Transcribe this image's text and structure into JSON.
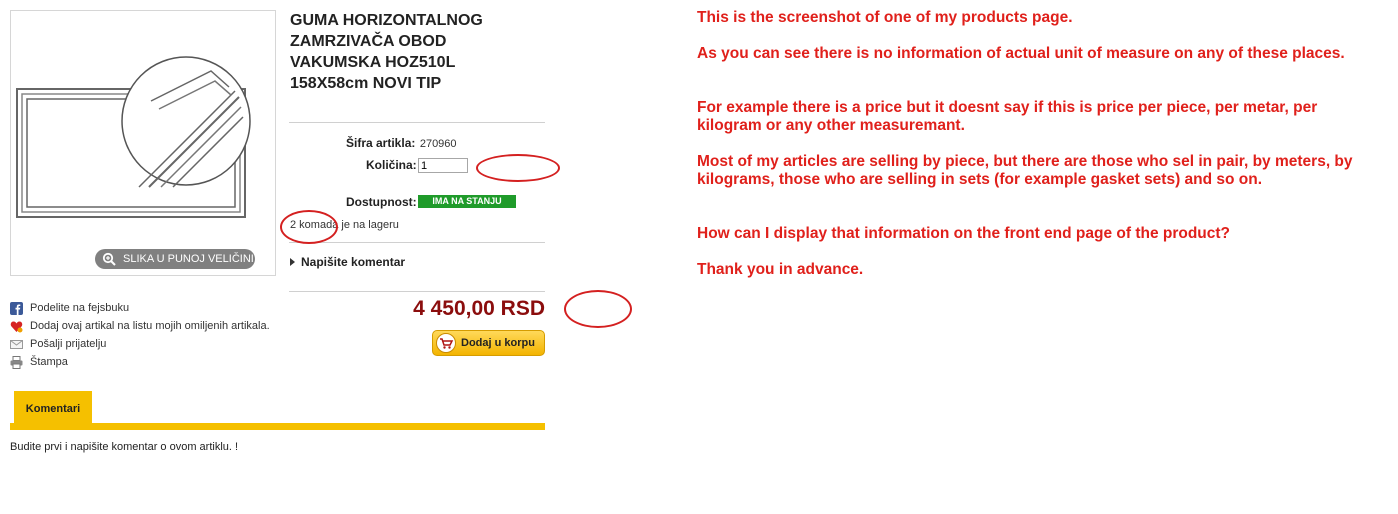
{
  "product": {
    "title": "GUMA HORIZONTALNOG ZAMRZIVAČA OBOD VAKUMSKA HOZ510L 158X58cm NOVI TIP",
    "zoom_label": "SLIKA U PUNOJ VELIČINI",
    "sku_label": "Šifra artikla:",
    "sku_value": "270960",
    "qty_label": "Količina:",
    "qty_value": "1",
    "availability_label": "Dostupnost:",
    "availability_badge": "IMA NA STANJU",
    "stock_count": "2 komada",
    "stock_suffix": "je na lageru",
    "comment_link": "Napišite komentar",
    "price": "4 450,00 RSD",
    "add_to_cart": "Dodaj u korpu"
  },
  "share": {
    "facebook": "Podelite na fejsbuku",
    "favorites": "Dodaj ovaj artikal na listu mojih omiljenih artikala.",
    "send_friend": "Pošalji prijatelju",
    "print": "Štampa"
  },
  "tabs": {
    "comments_label": "Komentari",
    "comments_text": "Budite prvi i napišite komentar o ovom artiklu. !"
  },
  "annotation": {
    "line1": "This is the screenshot of one of my products page.",
    "line2": "As you can see there is no information of actual unit of measure on any of these places.",
    "line3": "For example there is a price but it doesnt say if this is price per piece, per metar, per kilogram or any other measuremant.",
    "line4": "Most of my articles are selling by piece, but there are those who sel in pair, by meters, by kilograms, those who are selling in sets (for example gasket sets) and so on.",
    "line5": "How can I display that information on the front end page of the product?",
    "line6": "Thank you in advance."
  },
  "colors": {
    "price": "#8b0d0d",
    "accent_yellow": "#f5c000",
    "stock_green": "#1f9b2a",
    "annotation_red": "#e0201b"
  },
  "icons": [
    "magnifier-icon",
    "cart-icon",
    "facebook-icon",
    "heart-icon",
    "envelope-icon",
    "printer-icon",
    "triangle-right-icon"
  ]
}
